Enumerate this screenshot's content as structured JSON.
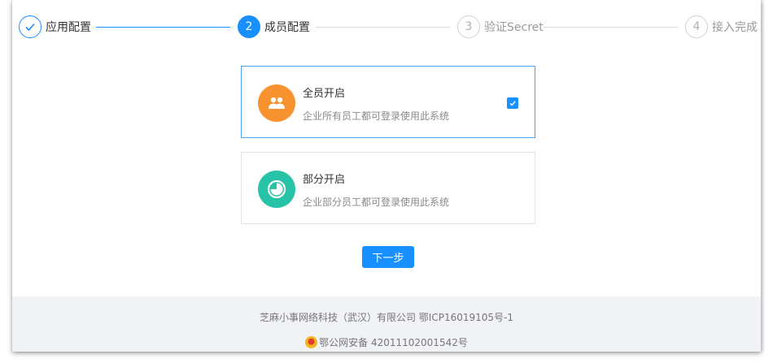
{
  "steps": [
    {
      "label": "应用配置",
      "number": "",
      "state": "done"
    },
    {
      "label": "成员配置",
      "number": "2",
      "state": "active"
    },
    {
      "label": "验证Secret",
      "number": "3",
      "state": "pending"
    },
    {
      "label": "接入完成",
      "number": "4",
      "state": "pending"
    }
  ],
  "options": [
    {
      "title": "全员开启",
      "desc": "企业所有员工都可登录使用此系统",
      "icon": "users-icon",
      "icon_color": "#f7922e",
      "selected": true
    },
    {
      "title": "部分开启",
      "desc": "企业部分员工都可登录使用此系统",
      "icon": "pie-chart-icon",
      "icon_color": "#26c3a6",
      "selected": false
    }
  ],
  "next_button": {
    "label": "下一步"
  },
  "footer": {
    "company": "芝麻小事网络科技（武汉）有限公司 鄂ICP16019105号-1",
    "police": "鄂公网安备 42011102001542号"
  },
  "colors": {
    "primary": "#1890ff",
    "footer_bg": "#f0f2f5"
  }
}
